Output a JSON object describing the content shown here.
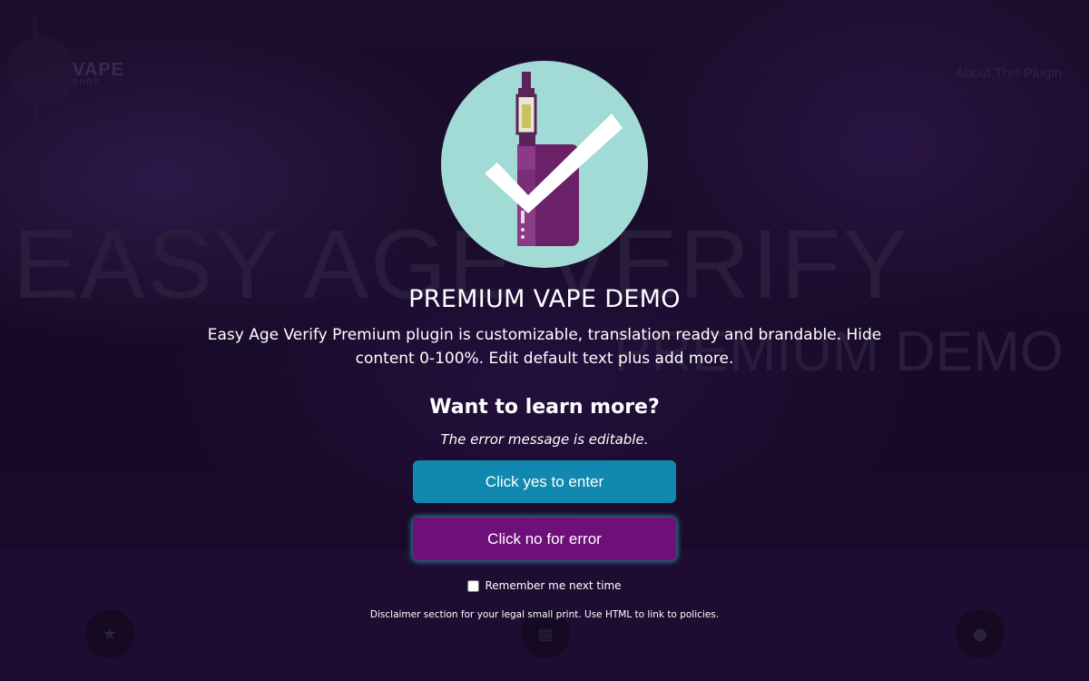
{
  "background_site": {
    "logo_text": "VAPE",
    "logo_sub": "SHOP",
    "nav_link": "About This Plugin",
    "hero_title": "EASY AGE VERIFY",
    "hero_subtitle": "PREMIUM DEMO"
  },
  "modal": {
    "title": "PREMIUM VAPE DEMO",
    "description": "Easy Age Verify Premium plugin is customizable, translation ready and brandable. Hide content 0-100%. Edit default text plus add more.",
    "question": "Want to learn more?",
    "error_message": "The error message is editable.",
    "yes_button": "Click yes to enter",
    "no_button": "Click no for error",
    "remember_label": "Remember me next time",
    "remember_checked": false,
    "disclaimer": "Disclaimer section for your legal small print. Use HTML to link to policies."
  },
  "colors": {
    "yes_button": "#1088b0",
    "no_button": "#6e0f7a",
    "badge_circle": "#a2dad5",
    "device": "#6a2168"
  },
  "icons": [
    "vape-checkmark-badge-icon",
    "star-icon",
    "grid-icon",
    "drop-icon"
  ]
}
